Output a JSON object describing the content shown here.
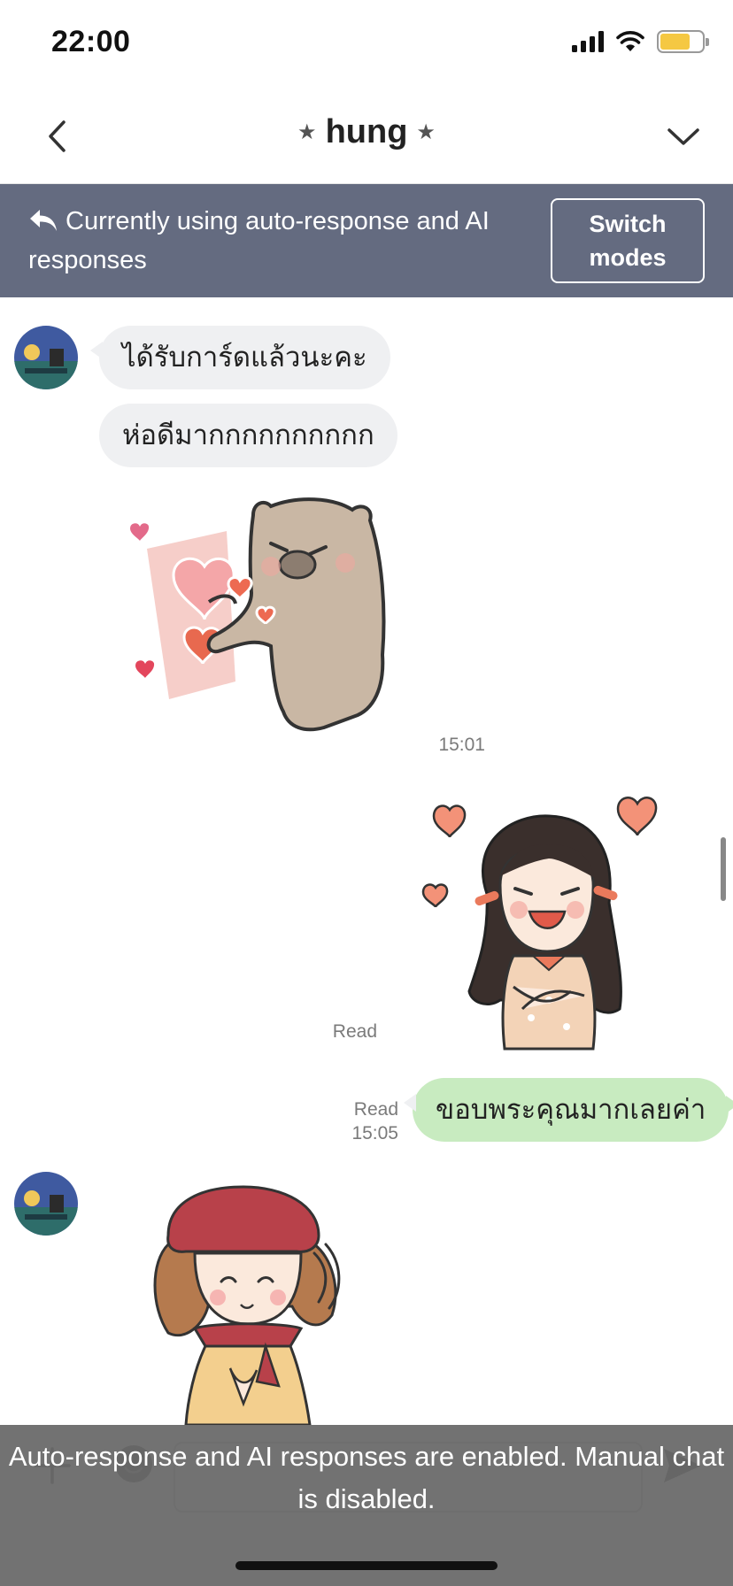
{
  "status_bar": {
    "time": "22:00"
  },
  "header": {
    "title": "hung",
    "title_prefix_star": "★",
    "title_suffix_star": "★"
  },
  "mode_banner": {
    "text": "Currently using auto-response and AI responses",
    "switch_button": "Switch modes"
  },
  "messages": [
    {
      "text": "ได้รับการ์ดแล้วนะคะ"
    },
    {
      "text": "ห่อดีมากกกกกกกกกก"
    }
  ],
  "sticker_bear": {
    "name": "bear-hearts-sticker",
    "time": "15:01"
  },
  "sticker_girl": {
    "name": "girl-laughing-hearts-sticker",
    "read": "Read"
  },
  "outgoing_message": {
    "text": "ขอบพระคุณมากเลยค่า",
    "read": "Read",
    "time": "15:05"
  },
  "sticker_bow": {
    "name": "girl-bowing-sticker"
  },
  "input": {
    "disabled_notice": "Auto-response and AI responses are enabled. Manual chat is disabled.",
    "placeholder": ""
  },
  "colors": {
    "banner": "#646b80",
    "incoming_bubble": "#eff0f2",
    "outgoing_bubble": "#c8ebc0",
    "battery": "#f5c842"
  }
}
